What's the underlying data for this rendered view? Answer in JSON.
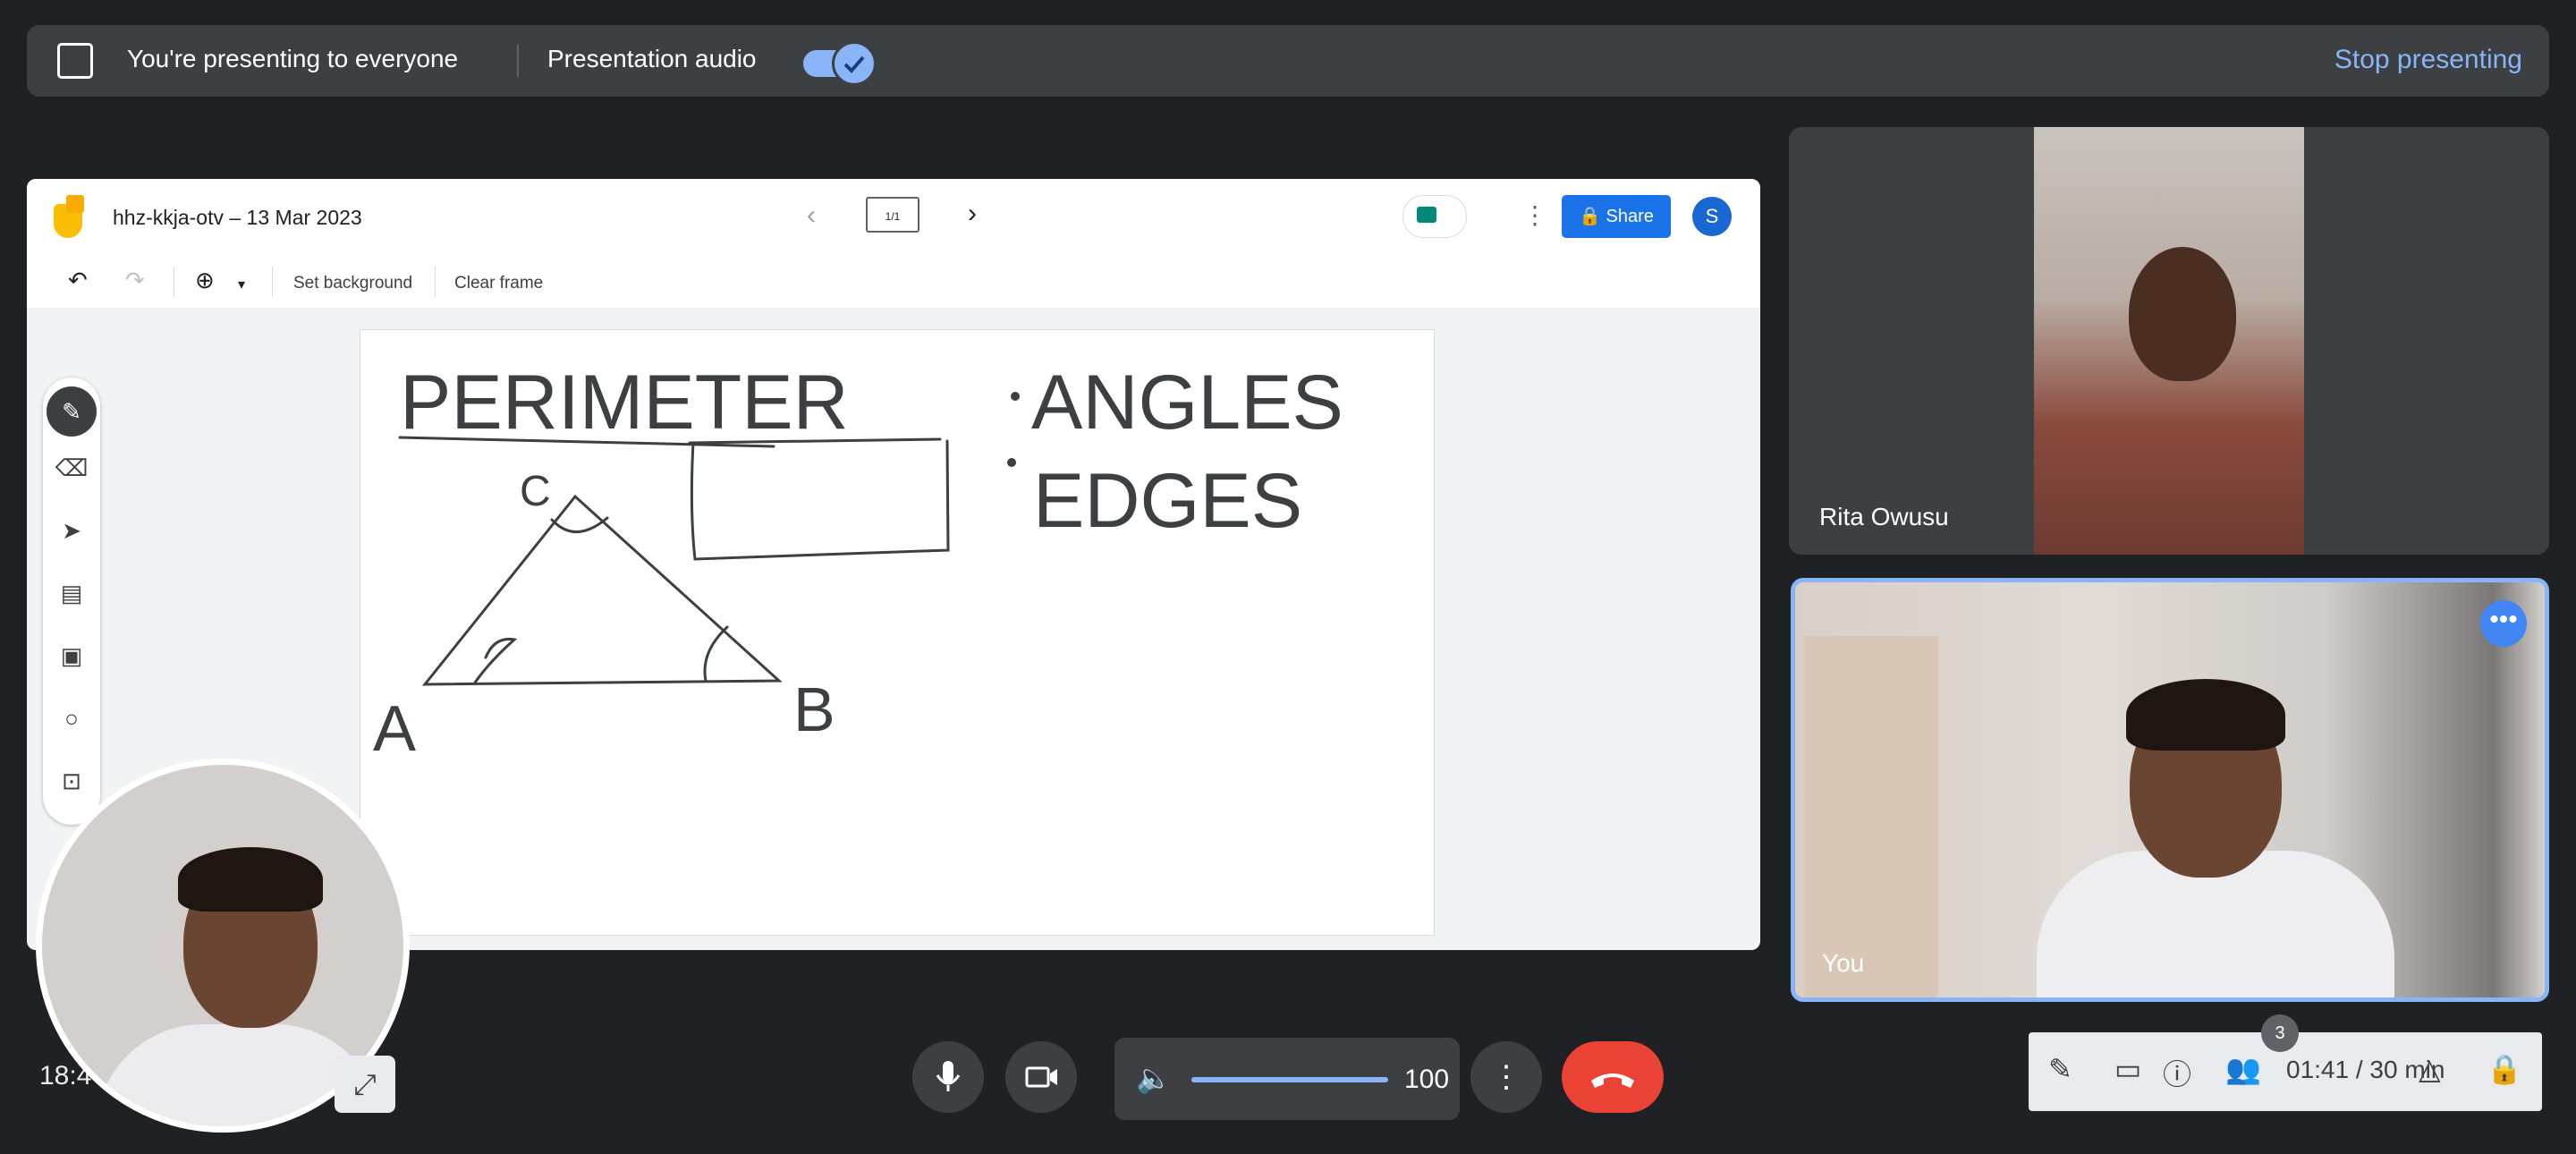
{
  "banner": {
    "presenting_text": "You're presenting to everyone",
    "audio_label": "Presentation audio",
    "audio_enabled": true,
    "stop_label": "Stop presenting"
  },
  "jamboard": {
    "title": "hhz-kkja-otv – 13 Mar 2023",
    "frame_indicator": "1/1",
    "share_label": "Share",
    "user_initial": "S",
    "toolbar": {
      "set_background": "Set background",
      "clear_frame": "Clear frame"
    },
    "tools": [
      "pen",
      "eraser",
      "select",
      "sticky-note",
      "image",
      "shape",
      "text-box"
    ],
    "canvas_text": {
      "heading": "PERIMETER",
      "vertex_c": "C",
      "vertex_a": "A",
      "vertex_b": "B",
      "bullet_angles": "ANGLES",
      "bullet_edges": "EDGES"
    }
  },
  "participants": [
    {
      "name": "Rita Owusu"
    },
    {
      "name": "You",
      "active": true
    }
  ],
  "self_view": {
    "clock": "18:4"
  },
  "controls": {
    "volume": 100
  },
  "right_panel": {
    "participant_count": "3",
    "timer": "01:41 / 30 min"
  },
  "colors": {
    "accent": "#8ab4f8",
    "share_blue": "#1a73e8",
    "hangup_red": "#ea4335",
    "banner_bg": "#3c4043"
  }
}
